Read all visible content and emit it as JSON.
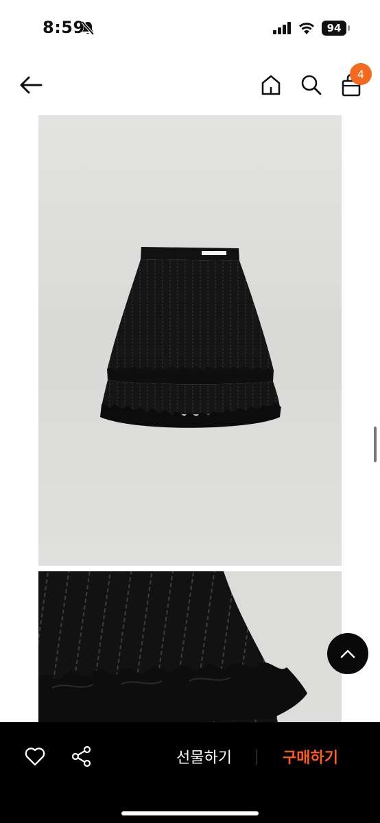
{
  "status_bar": {
    "time": "8:59",
    "battery": "94",
    "icons": [
      "bell-slash-icon",
      "signal-icon",
      "wifi-icon",
      "battery-icon"
    ]
  },
  "nav": {
    "icons": [
      "back-arrow-icon",
      "home-icon",
      "search-icon",
      "shopping-bag-icon"
    ],
    "cart_count": "4"
  },
  "product": {
    "images": [
      "product-photo-skirt",
      "detail-photo-ruffle-hem"
    ],
    "label_tag_color": "#ffffff"
  },
  "actions": {
    "gift_label": "선물하기",
    "buy_label": "구매하기",
    "icons": [
      "heart-icon",
      "share-icon",
      "chevron-up-icon"
    ]
  },
  "colors": {
    "accent": "#ff5c16",
    "badge": "#f36a1f",
    "bottom_bar": "#000000"
  }
}
